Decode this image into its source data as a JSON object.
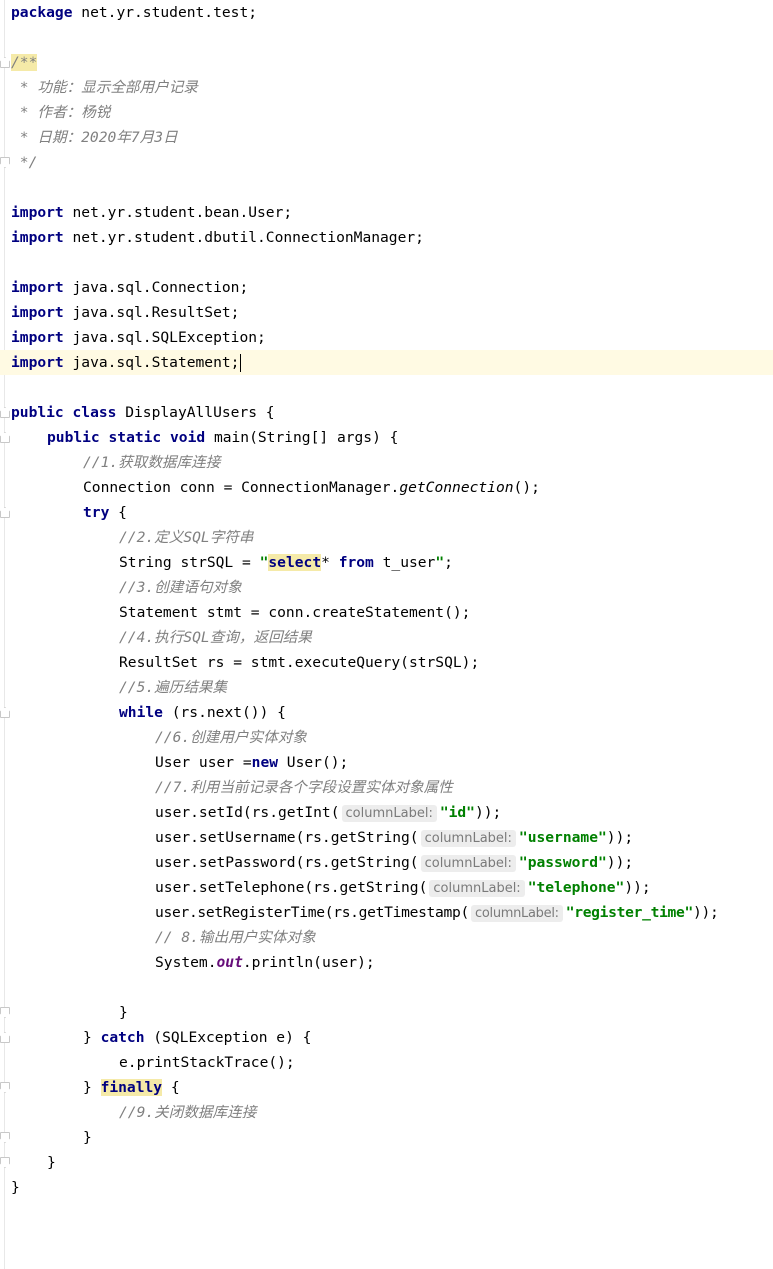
{
  "package_line": {
    "kw": "package",
    "name": " net.yr.student.test;"
  },
  "doc_comment": {
    "open": "/**",
    "l1": " * 功能：显示全部用户记录",
    "l2": " * 作者：杨锐",
    "l3": " * 日期：2020年7月3日",
    "close": " */"
  },
  "imports": [
    {
      "kw": "import",
      "name": " net.yr.student.bean.User;"
    },
    {
      "kw": "import",
      "name": " net.yr.student.dbutil.ConnectionManager;"
    },
    {
      "kw": "import",
      "name": " java.sql.Connection;"
    },
    {
      "kw": "import",
      "name": " java.sql.ResultSet;"
    },
    {
      "kw": "import",
      "name": " java.sql.SQLException;"
    },
    {
      "kw": "import",
      "name": " java.sql.Statement;"
    }
  ],
  "class_decl": {
    "kw": "public class",
    "rest": " DisplayAllUsers {"
  },
  "main_decl": {
    "kw": "public static void",
    "rest": " main(String[] args) {"
  },
  "comments": {
    "c1": "//1.获取数据库连接",
    "c2": "//2.定义SQL字符串",
    "c3": "//3.创建语句对象",
    "c4": "//4.执行SQL查询，返回结果",
    "c5": "//5.遍历结果集",
    "c6": "//6.创建用户实体对象",
    "c7": "//7.利用当前记录各个字段设置实体对象属性",
    "c8": "// 8.输出用户实体对象",
    "c9": "//9.关闭数据库连接"
  },
  "code": {
    "conn_pre": "Connection conn = ConnectionManager.",
    "conn_method": "getConnection",
    "conn_post": "();",
    "try_kw": "try",
    "try_rest": " {",
    "sql_pre": "String strSQL = ",
    "sql_q1": "\"",
    "sql_select": "select",
    "sql_star": "* ",
    "sql_from": "from",
    "sql_table": " t_user",
    "sql_q2": "\"",
    "sql_end": ";",
    "stmt": "Statement stmt = conn.createStatement();",
    "rs": "ResultSet rs = stmt.executeQuery(strSQL);",
    "while_kw": "while",
    "while_rest": " (rs.next()) {",
    "user_pre": "User user =",
    "user_new": "new",
    "user_post": " User();",
    "setters": [
      {
        "pre": "user.setId(rs.getInt(",
        "hint": "columnLabel:",
        "arg": "\"id\"",
        "post": "));"
      },
      {
        "pre": "user.setUsername(rs.getString(",
        "hint": "columnLabel:",
        "arg": "\"username\"",
        "post": "));"
      },
      {
        "pre": "user.setPassword(rs.getString(",
        "hint": "columnLabel:",
        "arg": "\"password\"",
        "post": "));"
      },
      {
        "pre": "user.setTelephone(rs.getString(",
        "hint": "columnLabel:",
        "arg": "\"telephone\"",
        "post": "));"
      },
      {
        "pre": "user.setRegisterTime(rs.getTimestamp(",
        "hint": "columnLabel:",
        "arg": "\"register_time\"",
        "post": "));"
      }
    ],
    "print_pre": "System.",
    "print_out": "out",
    "print_post": ".println(user);",
    "close_brace": "}",
    "catch_pre": "} ",
    "catch_kw": "catch",
    "catch_rest": " (SQLException e) {",
    "trace": "e.printStackTrace();",
    "finally_pre": "} ",
    "finally_kw": "finally",
    "finally_rest": " {"
  },
  "colors": {
    "keyword": "#000080",
    "comment": "#808080",
    "string": "#008000",
    "static_field": "#660e7a",
    "current_line": "#fffae3"
  }
}
